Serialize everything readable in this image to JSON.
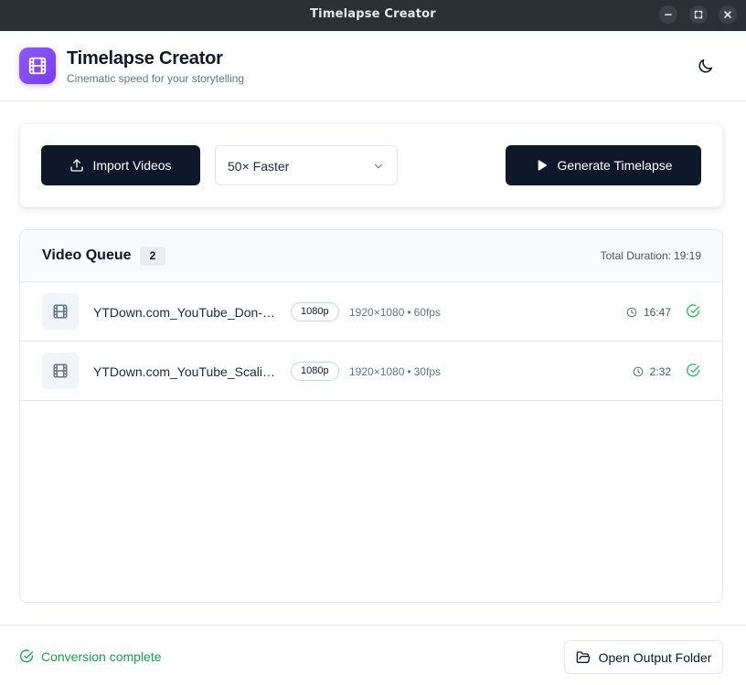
{
  "window": {
    "title": "Timelapse Creator",
    "controls": [
      "minimize-icon",
      "maximize-icon",
      "close-icon"
    ]
  },
  "header": {
    "app_name": "Timelapse Creator",
    "tagline": "Cinematic speed for your storytelling",
    "logo_icon": "film-icon",
    "theme_icon": "moon-icon"
  },
  "toolbar": {
    "import_label": "Import Videos",
    "import_icon": "upload-icon",
    "speed_selected": "50× Faster",
    "generate_label": "Generate Timelapse",
    "generate_icon": "play-icon"
  },
  "queue": {
    "title": "Video Queue",
    "count": "2",
    "total_label": "Total Duration:",
    "total_value": "19:19",
    "items": [
      {
        "name": "YTDown.com_YouTube_Don-…",
        "quality": "1080p",
        "resolution": "1920×1080",
        "fps": "60fps",
        "duration": "16:47",
        "status_icon": "check-circle-icon"
      },
      {
        "name": "YTDown.com_YouTube_Scali…",
        "quality": "1080p",
        "resolution": "1920×1080",
        "fps": "30fps",
        "duration": "2:32",
        "status_icon": "check-circle-icon"
      }
    ]
  },
  "footer": {
    "status_text": "Conversion complete",
    "open_folder_label": "Open Output Folder",
    "open_folder_icon": "folder-open-icon"
  },
  "colors": {
    "accent": "#7c3aed",
    "primary_button": "#0f172a",
    "success": "#16a34a",
    "titlebar": "#2b3036"
  }
}
